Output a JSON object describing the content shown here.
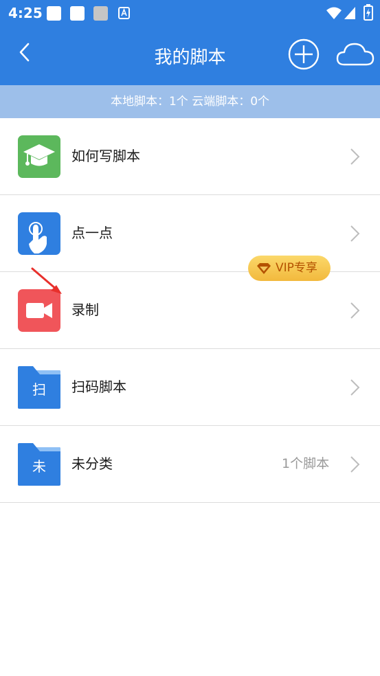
{
  "status_bar": {
    "time": "4:25"
  },
  "header": {
    "title": "我的脚本"
  },
  "summary": "本地脚本：1个 云端脚本：0个",
  "rows": [
    {
      "label": "如何写脚本",
      "icon": "graduation-cap-icon",
      "icon_bg": "#5cb85c"
    },
    {
      "label": "点一点",
      "icon": "tap-hand-icon",
      "icon_bg": "#2f7fe0"
    },
    {
      "label": "录制",
      "icon": "video-camera-icon",
      "icon_bg": "#f0555a"
    },
    {
      "label": "扫码脚本",
      "icon": "folder-icon",
      "icon_char": "扫",
      "icon_bg": "#2f7fe0",
      "badge": "VIP专享"
    },
    {
      "label": "未分类",
      "icon": "folder-icon",
      "icon_char": "未",
      "icon_bg": "#2f7fe0",
      "count": "1个脚本"
    }
  ],
  "colors": {
    "primary": "#2f7fe0",
    "summary_bg": "#9dbfea",
    "vip_text": "#b45200"
  }
}
